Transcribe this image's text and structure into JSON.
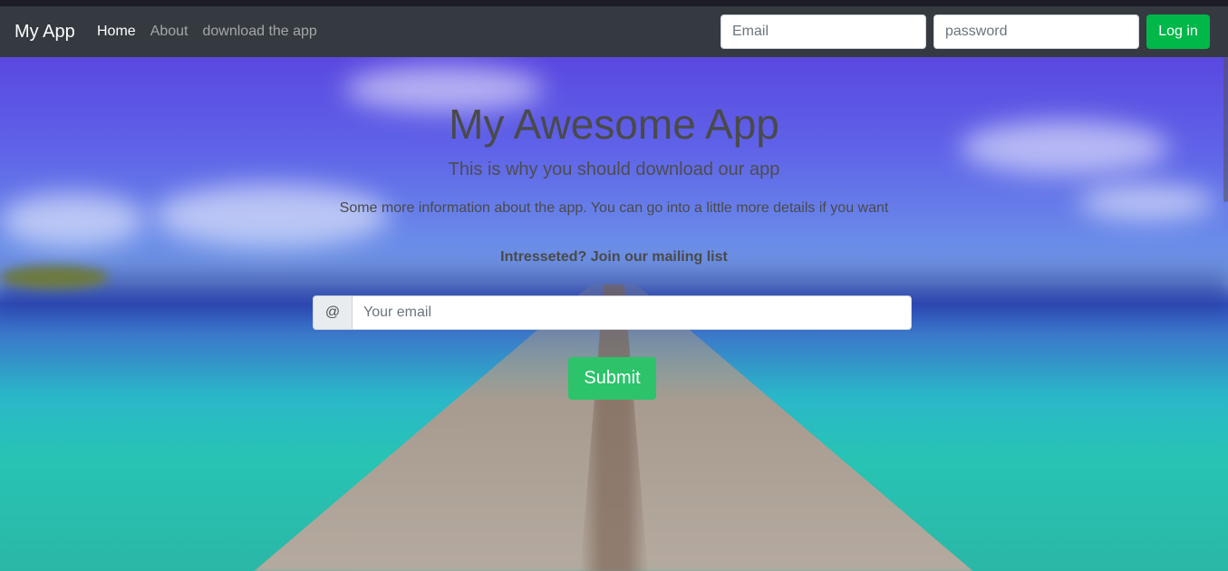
{
  "navbar": {
    "brand": "My App",
    "links": [
      {
        "label": "Home",
        "active": true
      },
      {
        "label": "About",
        "active": false
      },
      {
        "label": "download the app",
        "active": false
      }
    ],
    "email_placeholder": "Email",
    "password_placeholder": "password",
    "login_label": "Log in"
  },
  "hero": {
    "title": "My Awesome App",
    "subtitle": "This is why you should download our app",
    "info": "Some more information about the app. You can go into a little more details if you want",
    "cta": "Intresseted? Join our mailing list",
    "addon": "@",
    "email_placeholder": "Your email",
    "submit_label": "Submit"
  },
  "colors": {
    "navbar_bg": "#343a40",
    "login_button": "#00b74a",
    "submit_button": "#2cc36b"
  }
}
